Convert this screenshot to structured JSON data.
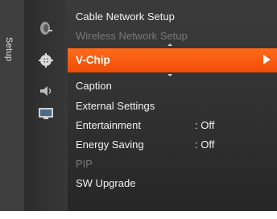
{
  "menu": {
    "side_tab_label": "Setup",
    "items": [
      {
        "label": "Cable Network Setup",
        "value": "",
        "state": "enabled"
      },
      {
        "label": "Wireless Network Setup",
        "value": "",
        "state": "disabled"
      },
      {
        "label": "V-Chip",
        "value": "",
        "state": "selected"
      },
      {
        "label": "Caption",
        "value": "",
        "state": "enabled"
      },
      {
        "label": "External Settings",
        "value": "",
        "state": "enabled"
      },
      {
        "label": "Entertainment",
        "value": ": Off",
        "state": "enabled"
      },
      {
        "label": "Energy Saving",
        "value": ": Off",
        "state": "enabled"
      },
      {
        "label": "PIP",
        "value": "",
        "state": "disabled"
      },
      {
        "label": "SW Upgrade",
        "value": "",
        "state": "enabled"
      }
    ]
  },
  "icons": [
    "satellite-icon",
    "gear-icon",
    "speaker-icon",
    "tv-input-icon"
  ],
  "colors": {
    "selected_bg": "#f05a10",
    "panel_bg": "#333333",
    "text": "#f2f2f2",
    "disabled_text": "#7a7a7a"
  }
}
